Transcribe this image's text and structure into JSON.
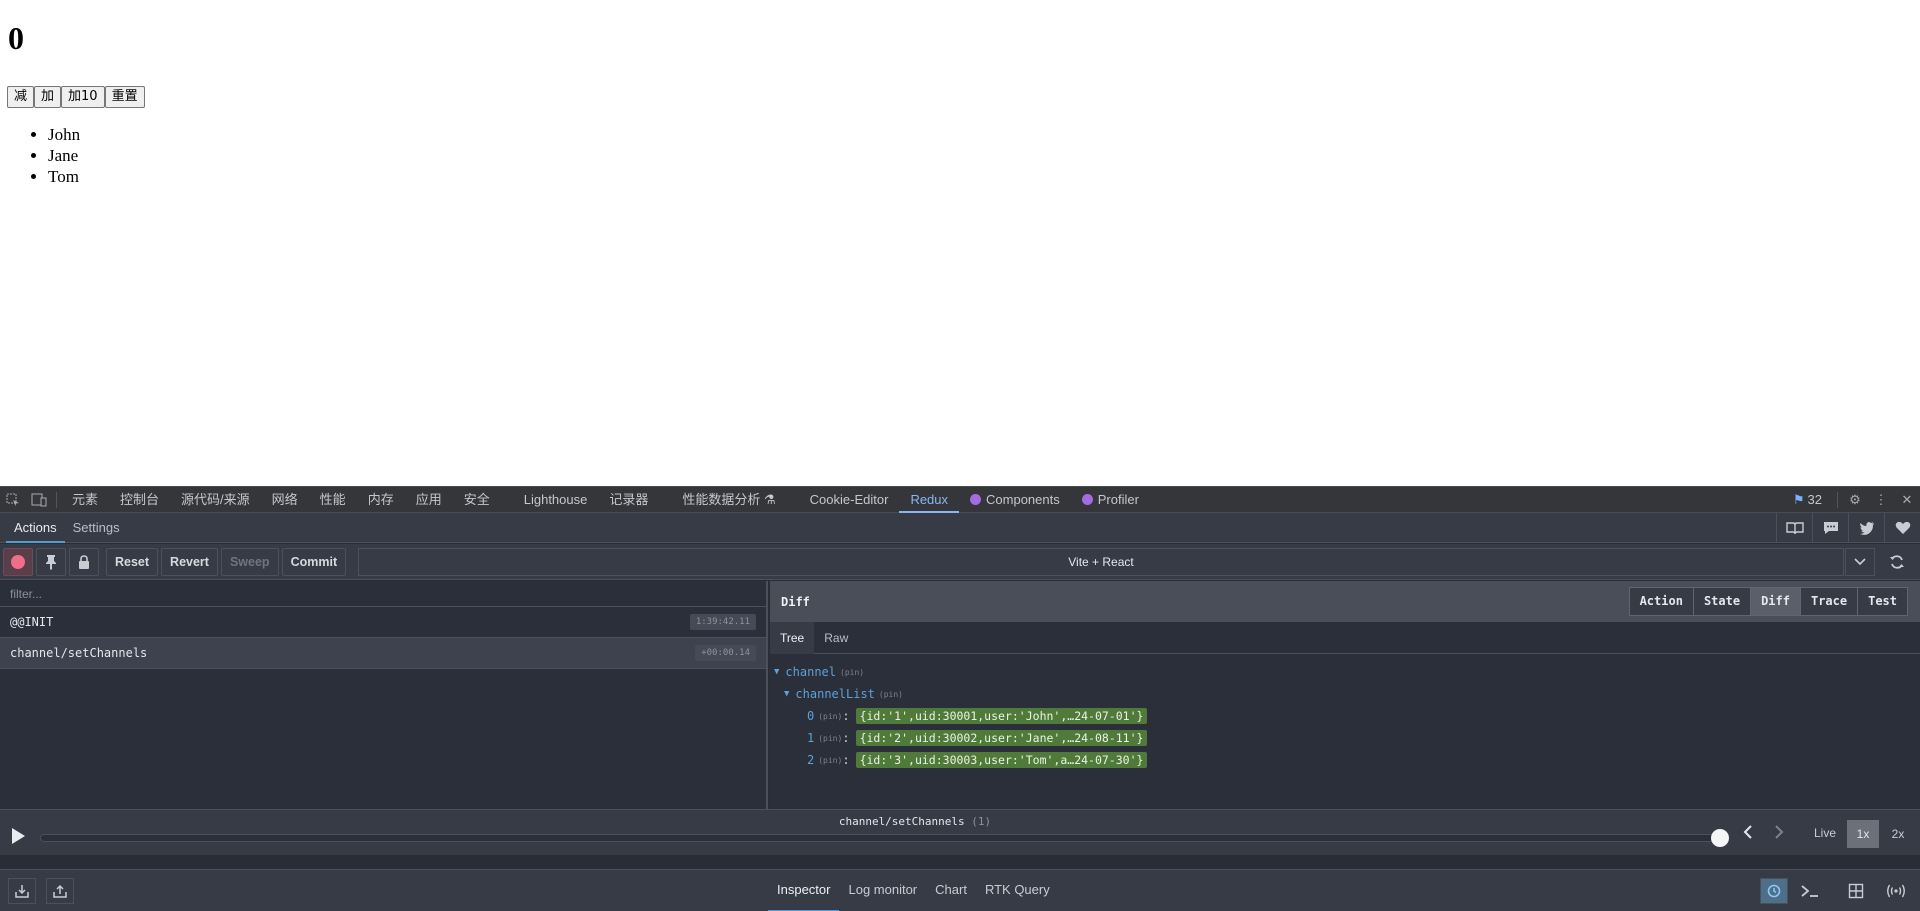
{
  "page": {
    "count": "0",
    "buttons": [
      "减",
      "加",
      "加10",
      "重置"
    ],
    "names": [
      "John",
      "Jane",
      "Tom"
    ]
  },
  "devtools": {
    "tabs": [
      "元素",
      "控制台",
      "源代码/来源",
      "网络",
      "性能",
      "内存",
      "应用",
      "安全",
      "Lighthouse",
      "记录器",
      "性能数据分析",
      "Cookie-Editor",
      "Redux",
      "Components",
      "Profiler"
    ],
    "active_tab": "Redux",
    "issues_count": "32",
    "icons": {
      "inspect": "inspect-icon",
      "device": "device-toolbar-icon",
      "settings": "gear-icon",
      "more": "kebab-menu-icon",
      "close": "close-icon"
    }
  },
  "redux": {
    "top_tabs": [
      "Actions",
      "Settings"
    ],
    "toolbar": {
      "reset": "Reset",
      "revert": "Revert",
      "sweep": "Sweep",
      "commit": "Commit"
    },
    "instance": "Vite + React",
    "filter_placeholder": "filter...",
    "actions": [
      {
        "type": "@@INIT",
        "time": "1:39:42.11"
      },
      {
        "type": "channel/setChannels",
        "time": "+00:00.14"
      }
    ],
    "monitor_title": "Diff",
    "monitor_tabs": [
      "Action",
      "State",
      "Diff",
      "Trace",
      "Test"
    ],
    "active_monitor_tab": "Diff",
    "sub_tabs": [
      "Tree",
      "Raw"
    ],
    "tree": {
      "root": "channel",
      "child": "channelList",
      "pin": "(pin)",
      "items": [
        {
          "index": "0",
          "value": "{id:'1',uid:30001,user:'John',…24-07-01'}"
        },
        {
          "index": "1",
          "value": "{id:'2',uid:30002,user:'Jane',…24-08-11'}"
        },
        {
          "index": "2",
          "value": "{id:'3',uid:30003,user:'Tom',a…24-07-30'}"
        }
      ]
    },
    "slider": {
      "label": "channel/setChannels",
      "count": "(1)",
      "live": "Live",
      "speeds": [
        "1x",
        "2x"
      ],
      "active_speed": "1x",
      "position": 1.0
    },
    "bottom_monitors": [
      "Inspector",
      "Log monitor",
      "Chart",
      "RTK Query"
    ],
    "active_monitor": "Inspector"
  }
}
